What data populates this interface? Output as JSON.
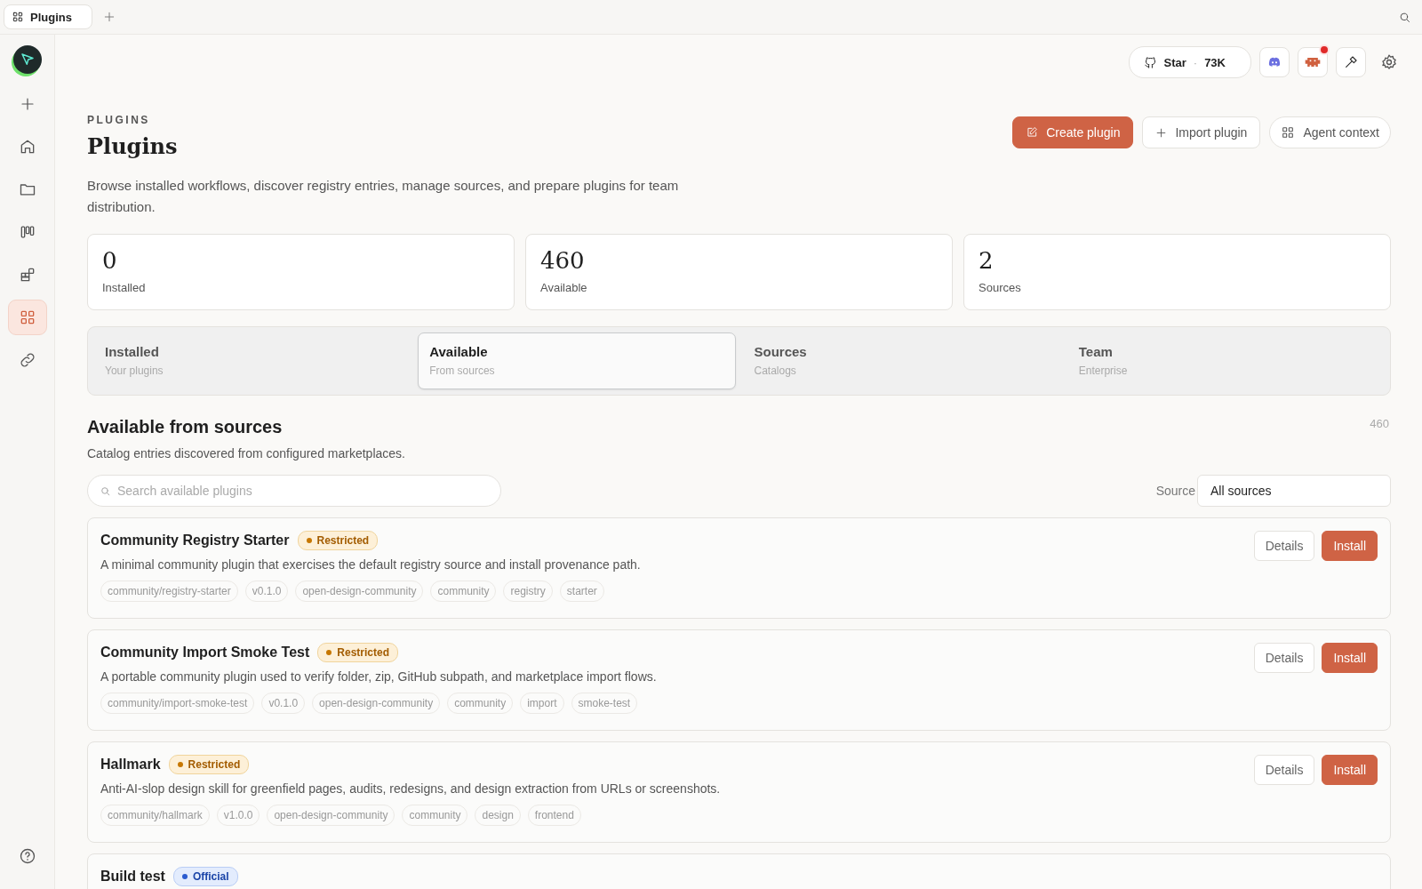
{
  "window_tabs": [
    {
      "label": "Plugins",
      "selected": true
    }
  ],
  "sidebar": {
    "items": [
      {
        "selected": false
      },
      {
        "selected": false
      },
      {
        "selected": false
      },
      {
        "selected": false
      },
      {
        "selected": false
      },
      {
        "selected": true
      },
      {
        "selected": false
      }
    ]
  },
  "toolbar": {
    "star_label": "Star",
    "star_separator": "·",
    "star_count": "73K",
    "notification": true
  },
  "header": {
    "eyebrow": "PLUGINS",
    "title": "Plugins",
    "description": "Browse installed workflows, discover registry entries, manage sources, and prepare plugins for team distribution.",
    "actions": [
      {
        "label": "Create plugin",
        "kind": "primary"
      },
      {
        "label": "Import plugin",
        "kind": "import"
      },
      {
        "label": "Agent context",
        "kind": "context"
      }
    ]
  },
  "stats": [
    {
      "value": "0",
      "label": "Installed"
    },
    {
      "value": "460",
      "label": "Available"
    },
    {
      "value": "2",
      "label": "Sources"
    }
  ],
  "tabs": [
    {
      "label": "Installed",
      "sublabel": "Your plugins",
      "selected": false
    },
    {
      "label": "Available",
      "sublabel": "From sources",
      "selected": true
    },
    {
      "label": "Sources",
      "sublabel": "Catalogs",
      "selected": false
    },
    {
      "label": "Team",
      "sublabel": "Enterprise",
      "selected": false
    }
  ],
  "section": {
    "title": "Available from sources",
    "subtitle": "Catalog entries discovered from configured marketplaces.",
    "count": "460"
  },
  "search": {
    "placeholder": "Search available plugins"
  },
  "source_filter": {
    "label": "Source",
    "value": "All sources"
  },
  "plugins": [
    {
      "name": "Community Registry Starter",
      "badge": {
        "label": "Restricted",
        "kind": "restricted"
      },
      "description": "A minimal community plugin that exercises the default registry source and install provenance path.",
      "tags": [
        "community/registry-starter",
        "v0.1.0",
        "open-design-community",
        "community",
        "registry",
        "starter"
      ],
      "buttons": [
        "Details",
        "Install"
      ]
    },
    {
      "name": "Community Import Smoke Test",
      "badge": {
        "label": "Restricted",
        "kind": "restricted"
      },
      "description": "A portable community plugin used to verify folder, zip, GitHub subpath, and marketplace import flows.",
      "tags": [
        "community/import-smoke-test",
        "v0.1.0",
        "open-design-community",
        "community",
        "import",
        "smoke-test"
      ],
      "buttons": [
        "Details",
        "Install"
      ]
    },
    {
      "name": "Hallmark",
      "badge": {
        "label": "Restricted",
        "kind": "restricted"
      },
      "description": "Anti-AI-slop design skill for greenfield pages, audits, redesigns, and design extraction from URLs or screenshots.",
      "tags": [
        "community/hallmark",
        "v1.0.0",
        "open-design-community",
        "community",
        "design",
        "frontend"
      ],
      "buttons": [
        "Details",
        "Install"
      ]
    },
    {
      "name": "Build test",
      "badge": {
        "label": "Official",
        "kind": "official"
      }
    }
  ]
}
